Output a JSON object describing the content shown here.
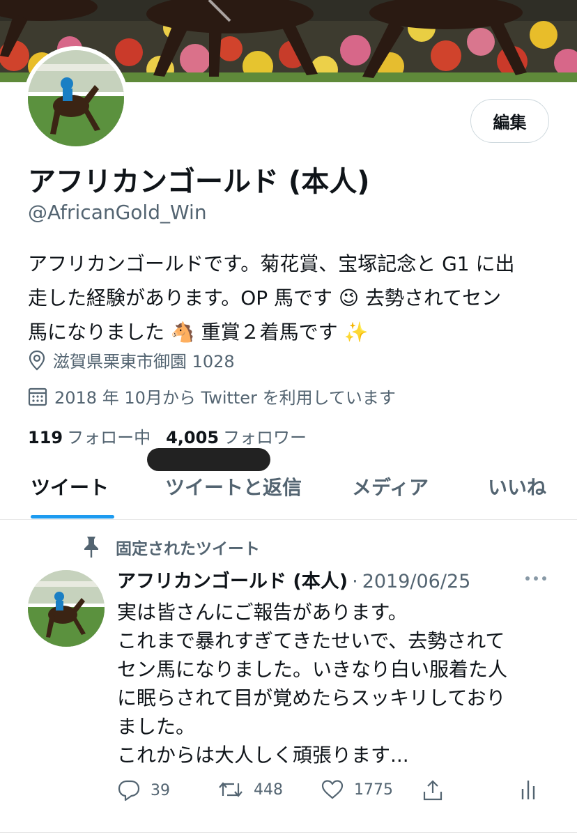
{
  "profile": {
    "display_name": "アフリカンゴールド (本人)",
    "handle": "@AfricanGold_Win",
    "edit_label": "編集",
    "bio_lines": [
      "アフリカンゴールドです。菊花賞、宝塚記念と G1 に出",
      "走した経験があります。OP 馬です 😉 去勢されてセン",
      "馬になりました 🐴 重賞２着馬です ✨"
    ],
    "location": "滋賀県栗東市御園 1028",
    "joined": "2018 年 10月から Twitter を利用しています",
    "following_count": "119",
    "following_label": "フォロー中",
    "followers_count": "4,005",
    "followers_label": "フォロワー"
  },
  "tabs": [
    {
      "label": "ツイート",
      "active": true
    },
    {
      "label": "ツイートと返信",
      "active": false
    },
    {
      "label": "メディア",
      "active": false
    },
    {
      "label": "いいね",
      "active": false
    }
  ],
  "pinned_tweet": {
    "pinned_label": "固定されたツイート",
    "author_name": "アフリカンゴールド (本人)",
    "separator": "·",
    "date": "2019/06/25",
    "text_lines": [
      "実は皆さんにご報告があります。",
      "これまで暴れすぎてきたせいで、去勢されて",
      "セン馬になりました。いきなり白い服着た人",
      "に眠らされて目が覚めたらスッキリしており",
      "ました。",
      "これからは大人しく頑張ります..."
    ],
    "reply_count": "39",
    "retweet_count": "448",
    "like_count": "1775"
  },
  "icons": {
    "location": "location-pin-icon",
    "calendar": "calendar-icon",
    "pin": "pin-icon",
    "more": "more-dots-icon",
    "reply": "reply-icon",
    "retweet": "retweet-icon",
    "like": "heart-icon",
    "share": "share-icon",
    "analytics": "analytics-icon"
  },
  "colors": {
    "accent": "#1d9bf0",
    "text_primary": "#0f1419",
    "text_secondary": "#536471"
  }
}
